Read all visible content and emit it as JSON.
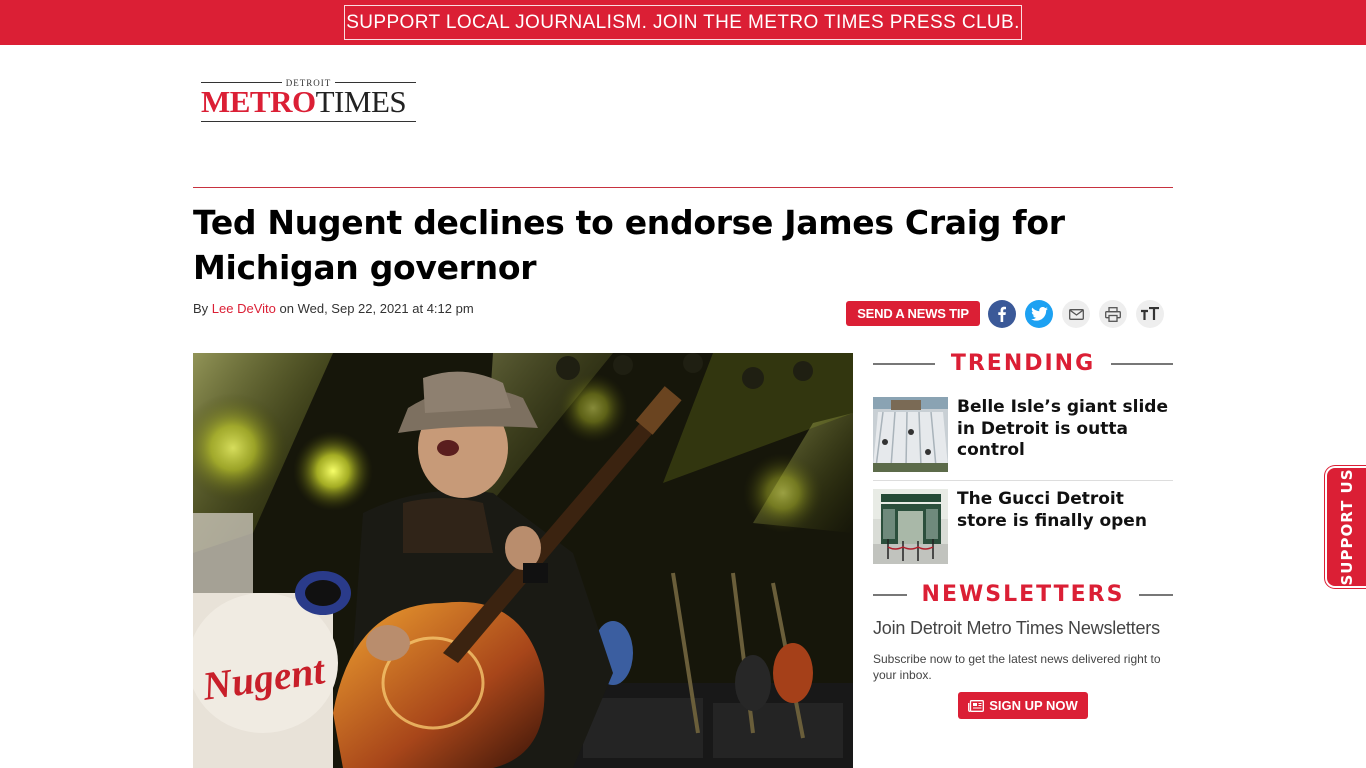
{
  "banner": {
    "text": "SUPPORT LOCAL JOURNALISM. JOIN THE METRO TIMES PRESS CLUB."
  },
  "logo": {
    "top": "DETROIT",
    "metro": "METRO",
    "times": "TIMES"
  },
  "article": {
    "headline": "Ted Nugent declines to endorse James Craig for Michigan governor",
    "by_prefix": "By ",
    "author": "Lee DeVito",
    "date_text": " on Wed, Sep 22, 2021 at 4:12 pm"
  },
  "share": {
    "tip_label": "SEND A NEWS TIP",
    "icons": [
      "facebook-icon",
      "twitter-icon",
      "email-icon",
      "print-icon",
      "text-size-icon"
    ]
  },
  "trending": {
    "heading": "TRENDING",
    "items": [
      {
        "title": "Belle Isle’s giant slide in Detroit is outta control"
      },
      {
        "title": "The Gucci Detroit store is finally open"
      }
    ]
  },
  "newsletters": {
    "heading": "NEWSLETTERS",
    "title": "Join Detroit Metro Times Newsletters",
    "description": "Subscribe now to get the latest news delivered right to your inbox.",
    "button_label": "SIGN UP NOW"
  },
  "support_tab": {
    "label": "SUPPORT US"
  },
  "colors": {
    "brand_red": "#db1f35",
    "facebook": "#3b5998",
    "twitter": "#1da1f2"
  }
}
